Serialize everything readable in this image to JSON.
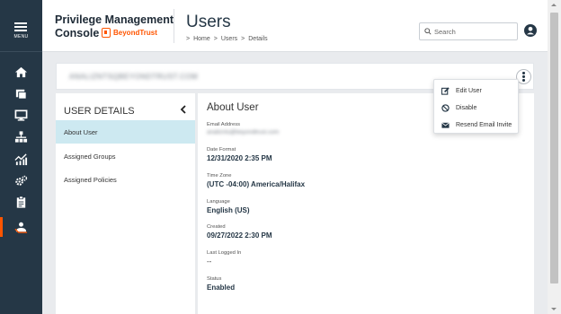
{
  "rail": {
    "menu_label": "MENU",
    "items": [
      {
        "icon": "home-icon"
      },
      {
        "icon": "policies-icon"
      },
      {
        "icon": "computers-icon"
      },
      {
        "icon": "groups-icon"
      },
      {
        "icon": "analytics-icon"
      },
      {
        "icon": "configuration-icon"
      },
      {
        "icon": "reports-icon"
      },
      {
        "icon": "users-icon",
        "active": true
      }
    ],
    "accent": "#ff5500"
  },
  "header": {
    "brand_line1": "Privilege Management",
    "brand_line2": "Console",
    "logo_text": "BeyondTrust",
    "title": "Users",
    "breadcrumb": [
      "Home",
      "Users",
      "Details"
    ],
    "breadcrumb_sep": ">",
    "search_placeholder": "Search"
  },
  "email_bar": {
    "email_redacted": "ANALIZNTSQBEYONDTRUST.COM"
  },
  "actions_menu": {
    "items": [
      {
        "label": "Edit User",
        "icon": "edit-icon"
      },
      {
        "label": "Disable",
        "icon": "disable-icon"
      },
      {
        "label": "Resend Email Invite",
        "icon": "envelope-icon"
      }
    ]
  },
  "user_details": {
    "title": "USER DETAILS",
    "nav": [
      {
        "label": "About User",
        "active": true
      },
      {
        "label": "Assigned Groups"
      },
      {
        "label": "Assigned Policies"
      }
    ]
  },
  "about": {
    "title": "About User",
    "fields": [
      {
        "label": "Email Address",
        "value": "analiznts@beyondtrust.com",
        "redacted": true
      },
      {
        "label": "Date Format",
        "value": "12/31/2020 2:35 PM"
      },
      {
        "label": "Time Zone",
        "value": "(UTC -04:00) America/Halifax"
      },
      {
        "label": "Language",
        "value": "English (US)"
      },
      {
        "label": "Created",
        "value": "09/27/2022 2:30 PM"
      },
      {
        "label": "Last Logged In",
        "value": "--"
      },
      {
        "label": "Status",
        "value": "Enabled"
      }
    ]
  },
  "colors": {
    "rail_bg": "#253746",
    "active_nav_bg": "#cde9f1",
    "brand_orange": "#ff5500",
    "avatar_blue": "#253746"
  }
}
